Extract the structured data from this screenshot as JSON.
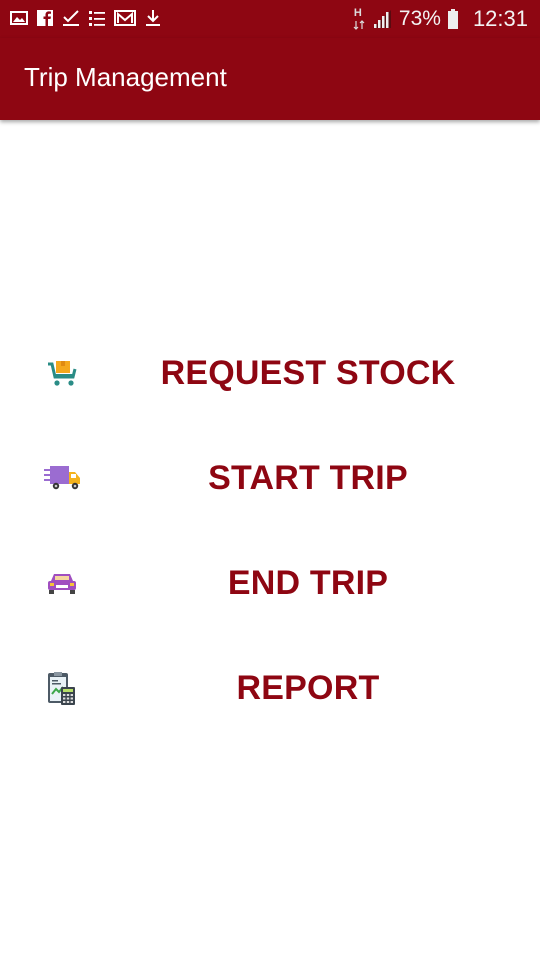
{
  "status_bar": {
    "left_icons": [
      "image-icon",
      "facebook-icon",
      "checkmark-icon",
      "list-icon",
      "mail-icon",
      "download-icon"
    ],
    "network": "H",
    "battery_percent": "73%",
    "time": "12:31"
  },
  "appbar": {
    "title": "Trip Management",
    "color": "#8e0612"
  },
  "menu": {
    "items": [
      {
        "label": "REQUEST STOCK",
        "icon": "shopping-cart-icon"
      },
      {
        "label": "START TRIP",
        "icon": "delivery-truck-icon"
      },
      {
        "label": "END TRIP",
        "icon": "car-icon"
      },
      {
        "label": "REPORT",
        "icon": "report-calculator-icon"
      }
    ],
    "label_color": "#8e0612"
  }
}
